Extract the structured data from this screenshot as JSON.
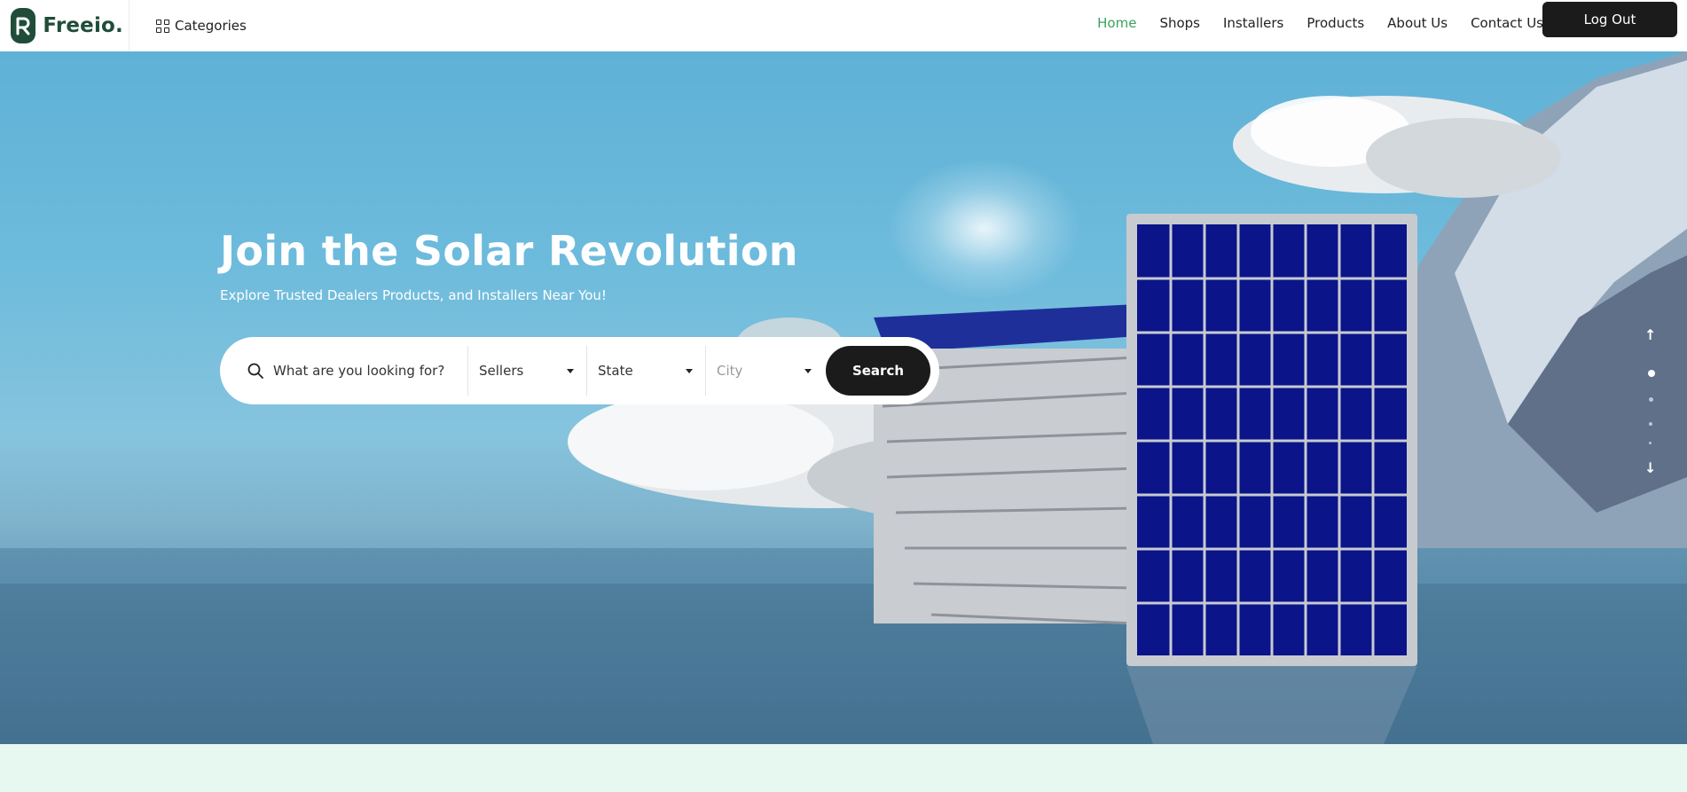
{
  "brand": {
    "name": "Freeio.",
    "logo_letter": "R"
  },
  "header": {
    "categories_label": "Categories",
    "nav": [
      {
        "label": "Home",
        "active": true
      },
      {
        "label": "Shops",
        "active": false
      },
      {
        "label": "Installers",
        "active": false
      },
      {
        "label": "Products",
        "active": false
      },
      {
        "label": "About Us",
        "active": false
      },
      {
        "label": "Contact Us",
        "active": false
      }
    ],
    "logout_label": "Log Out"
  },
  "hero": {
    "title": "Join the Solar Revolution",
    "subtitle": "Explore Trusted Dealers Products, and Installers Near You!",
    "search": {
      "placeholder": "What are you looking for?",
      "sellers_label": "Sellers",
      "state_label": "State",
      "city_label": "City",
      "button_label": "Search"
    },
    "slider": {
      "up_icon": "arrow-up-icon",
      "down_icon": "arrow-down-icon",
      "active_index": 0,
      "dot_count": 4
    }
  },
  "colors": {
    "brand_green": "#1f4d3a",
    "nav_active": "#3aa35b",
    "button_dark": "#1b1b1b",
    "hero_sky": "#6dbbdc",
    "band_bg": "#e7f8f1",
    "panel_blue": "#0b1489"
  }
}
